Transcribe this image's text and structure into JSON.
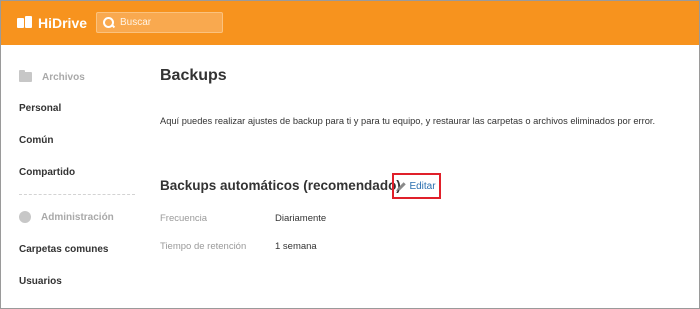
{
  "header": {
    "logo_text": "HiDrive",
    "search_placeholder": "Buscar",
    "bar_color": "#f7931e"
  },
  "sidebar": {
    "files_heading": "Archivos",
    "items": [
      "Personal",
      "Común",
      "Compartido"
    ],
    "admin_heading": "Administración",
    "admin_items": [
      "Carpetas comunes",
      "Usuarios"
    ]
  },
  "main": {
    "title": "Backups",
    "description": "Aquí puedes realizar ajustes de backup para ti y para tu equipo, y restaurar las carpetas o archivos eliminados por error.",
    "section_title": "Backups automáticos (recomendado)",
    "edit_label": "Editar",
    "highlight_color": "#e0202a",
    "fields": [
      {
        "label": "Frecuencia",
        "value": "Diariamente"
      },
      {
        "label": "Tiempo de retención",
        "value": "1 semana"
      }
    ]
  }
}
